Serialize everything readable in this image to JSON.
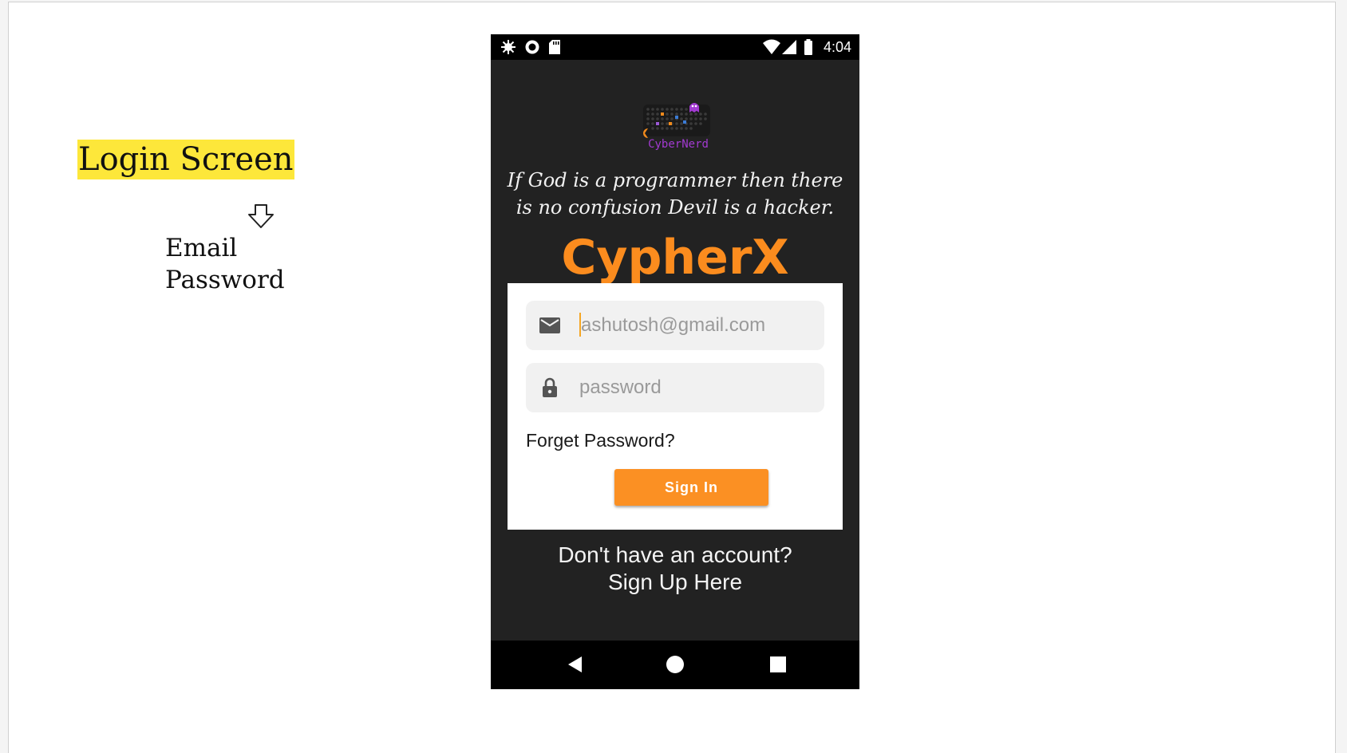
{
  "slide": {
    "title": "Login Screen",
    "items": [
      "Email",
      "Password"
    ],
    "icons": {
      "arrow": "down-arrow-icon"
    }
  },
  "phone": {
    "status_bar": {
      "time": "4:04",
      "icons": [
        "bug-icon",
        "record-icon",
        "sd-card-icon",
        "wifi-icon",
        "signal-icon",
        "battery-icon"
      ]
    },
    "logo_text": "CyberNerd",
    "quote": "If God is a programmer then there is no confusion Devil is a hacker.",
    "app_name": "CypherX",
    "form": {
      "email_value": "ashutosh@gmail.com",
      "password_placeholder": "password",
      "forget_label": "Forget Password?",
      "signin_label": "Sign In"
    },
    "signup": {
      "line1": "Don't have an account?",
      "line2": "Sign Up Here"
    },
    "colors": {
      "background": "#222222",
      "accent": "#fb8c1e",
      "logo_purple": "#a23ad1",
      "highlight": "#fde73a"
    },
    "nav": {
      "icons": [
        "back-icon",
        "home-icon",
        "recents-icon"
      ]
    }
  }
}
